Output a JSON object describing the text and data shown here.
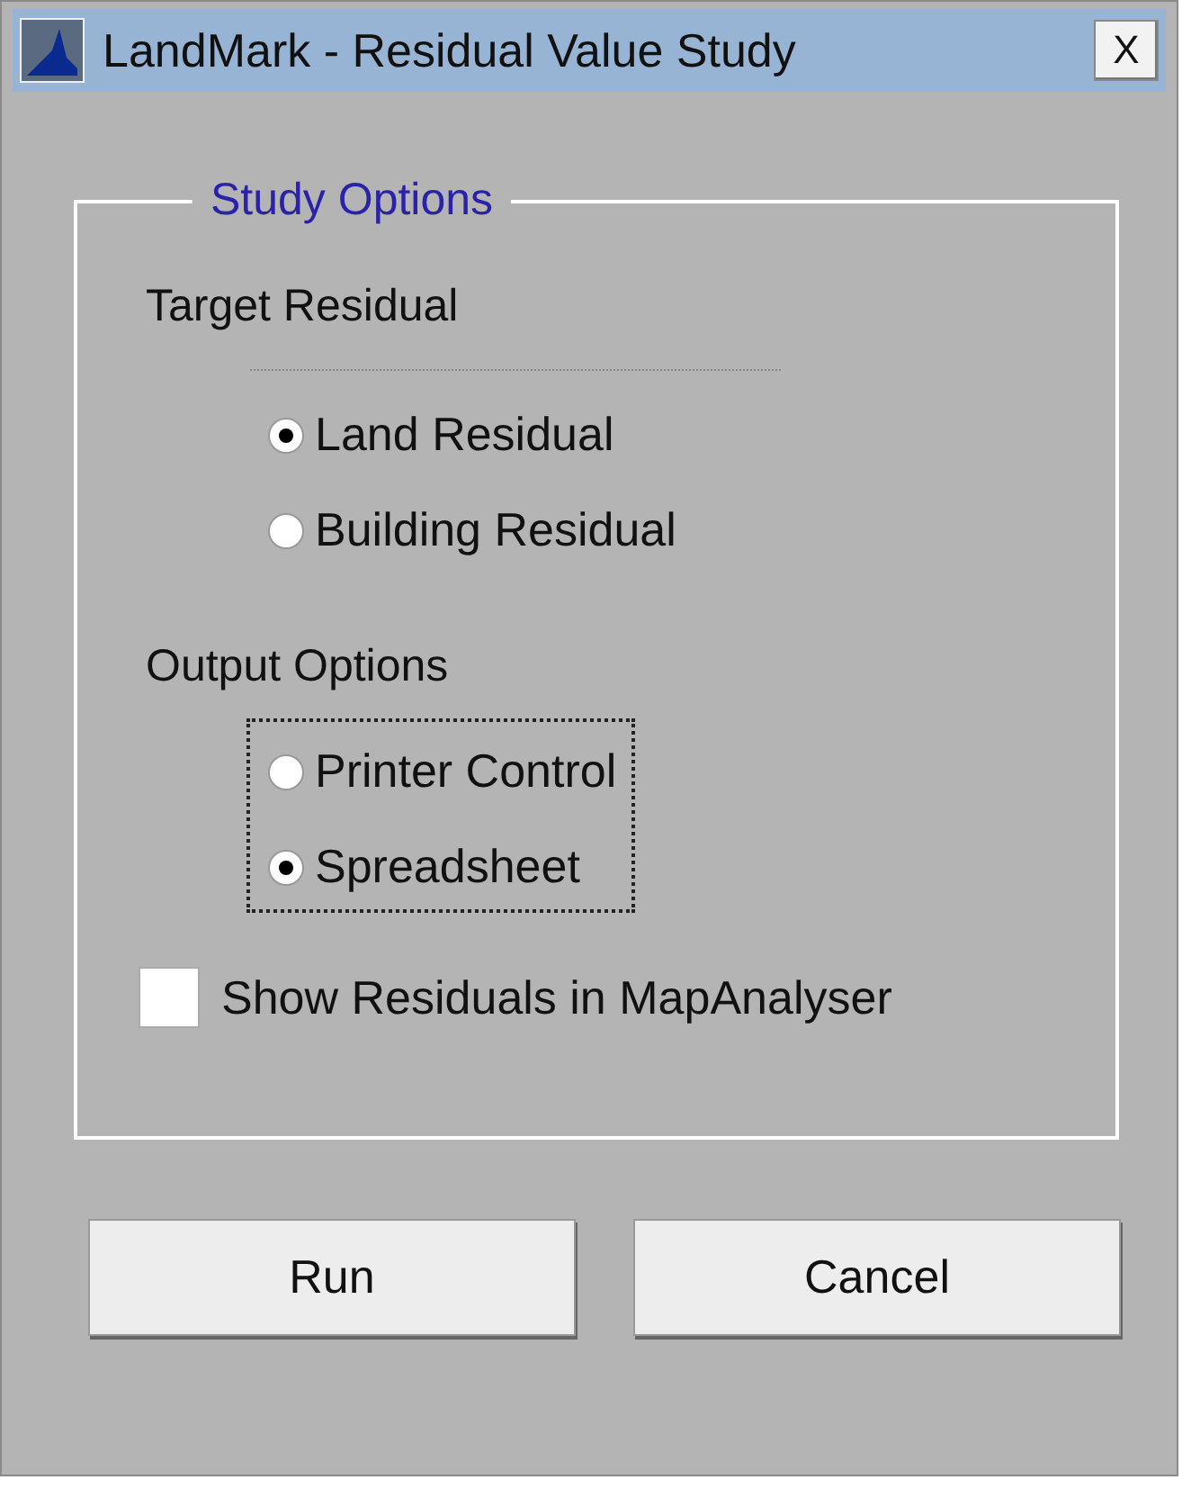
{
  "window": {
    "title": "LandMark - Residual Value Study",
    "close": "X"
  },
  "group": {
    "legend": "Study Options",
    "sections": [
      {
        "heading": "Target Residual",
        "focused": false,
        "options": [
          {
            "label": "Land Residual",
            "selected": true
          },
          {
            "label": "Building Residual",
            "selected": false
          }
        ]
      },
      {
        "heading": "Output Options",
        "focused": true,
        "options": [
          {
            "label": "Printer Control",
            "selected": false
          },
          {
            "label": "Spreadsheet",
            "selected": true
          }
        ]
      }
    ],
    "checkbox": {
      "label": "Show Residuals in MapAnalyser",
      "checked": false
    }
  },
  "buttons": [
    "Run",
    "Cancel"
  ]
}
